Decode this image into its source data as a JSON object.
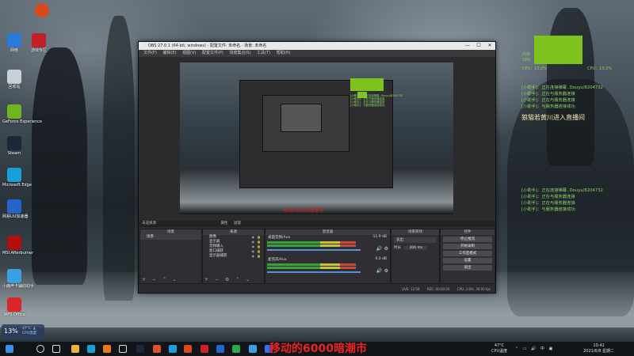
{
  "desktop": {
    "icons": [
      {
        "label": "网络",
        "icon": "network-icon",
        "color": "#2a7ad8"
      },
      {
        "label": "游戏专区",
        "icon": "game-zone-icon",
        "color": "#c0202a"
      },
      {
        "label": "回收站",
        "icon": "recycle-bin-icon",
        "color": "#c8d0d8"
      },
      {
        "label": "GeForce Experience",
        "icon": "geforce-icon",
        "color": "#6fb520"
      },
      {
        "label": "Steam",
        "icon": "steam-icon",
        "color": "#1b2838"
      },
      {
        "label": "Microsoft Edge",
        "icon": "edge-icon",
        "color": "#1aa0d8"
      },
      {
        "label": "网易UU加速器",
        "icon": "uu-accelerator-icon",
        "color": "#2563c8"
      },
      {
        "label": "MSI Afterburner",
        "icon": "afterburner-icon",
        "color": "#b01010"
      },
      {
        "label": "小鹿声卡辅助助手",
        "icon": "deer-icon",
        "color": "#3aa0e0"
      },
      {
        "label": "WPS Office",
        "icon": "wps-icon",
        "color": "#d8262a"
      }
    ],
    "top_icons": [
      {
        "label": "",
        "icon": "app-icon",
        "color": "#d84a1a"
      }
    ]
  },
  "stats_widget": {
    "bar_color": "#7ec21c",
    "lines": [
      "内存",
      "GPU",
      "CPU：15.2%",
      "CPU：13.2%"
    ]
  },
  "chat_top": [
    "[小助手]：正在连接弹幕..Douyu/8204732",
    "[小助手]：正在与服务器连接",
    "[小助手]：正在与服务器连接",
    "[小助手]：与服务器连接成功"
  ],
  "chat_highlight": "狼猫若黄川进入直播间",
  "chat_bottom": [
    "[小助手]：正在连接弹幕..Douyu/8204732",
    "[小助手]：正在与服务器连接",
    "[小助手]：正在与服务器连接",
    "[小助手]：与服务器连接成功"
  ],
  "obs": {
    "title": "OBS 27.0.1 (64-bit, windows) - 配置文件: 未命名 - 场景: 未命名",
    "menu": [
      "文件(F)",
      "编辑(E)",
      "视图(V)",
      "配置文件(P)",
      "场景集合(S)",
      "工具(T)",
      "帮助(H)"
    ],
    "preview_caption": "移动的6000暗潮市",
    "source_bar": {
      "label": "未选择源",
      "props": "属性",
      "filters": "滤镜"
    },
    "docks": {
      "scenes": {
        "header": "场景",
        "items": [
          "场景"
        ]
      },
      "sources": {
        "header": "来源",
        "items": [
          "图像",
          "显示器",
          "音频输入",
          "窗口捕获",
          "显示器捕获"
        ]
      },
      "mixer": {
        "header": "混音器",
        "channels": [
          {
            "name": "桌面音频/Aux",
            "db": "-11.9 dB"
          },
          {
            "name": "麦克风/Aux",
            "db": "0.0 dB"
          }
        ]
      },
      "transitions": {
        "header": "场景转场",
        "type": "淡出",
        "duration_label": "时长",
        "duration": "300 ms"
      },
      "controls": {
        "header": "控件",
        "buttons": [
          "停止推流",
          "开始录制",
          "工作室模式",
          "设置",
          "退出"
        ]
      }
    },
    "status": {
      "live": "LIVE: 12:58",
      "rec": "REC: 00:00:00",
      "cpu": "CPU: 3.8%, 30.00 fps"
    }
  },
  "cpu_widget": {
    "percent": "13%",
    "temp": "47°C 🌡",
    "label": "CPU温度"
  },
  "bottom_caption": "移动的6000暗潮市",
  "taskbar": {
    "icons": [
      {
        "icon": "windows-start-icon",
        "color": "#3b8fe8"
      },
      {
        "icon": "search-icon",
        "color": "#dddddd"
      },
      {
        "icon": "task-view-icon",
        "color": "#dddddd"
      },
      {
        "icon": "file-explorer-icon",
        "color": "#e8b43a"
      },
      {
        "icon": "edge-taskbar-icon",
        "color": "#1aa0d8"
      },
      {
        "icon": "fire-icon",
        "color": "#e87a1a"
      },
      {
        "icon": "obs-taskbar-icon",
        "color": "#dddddd"
      },
      {
        "icon": "steam-taskbar-icon",
        "color": "#1b2838"
      },
      {
        "icon": "chrome-icon",
        "color": "#e0502a"
      },
      {
        "icon": "edge2-icon",
        "color": "#1aa0d8"
      },
      {
        "icon": "game-icon",
        "color": "#d84a1a"
      },
      {
        "icon": "record-icon",
        "color": "#d0202a"
      },
      {
        "icon": "uu-icon",
        "color": "#2563c8"
      },
      {
        "icon": "photo-icon",
        "color": "#2aa84a"
      },
      {
        "icon": "deer-taskbar-icon",
        "color": "#3aa0e0"
      },
      {
        "icon": "screenshot-icon",
        "color": "#3b6fe8"
      }
    ],
    "temp": "47°C",
    "temp_label": "CPU温度",
    "time": "10:42",
    "date": "2021/6/8 星期二"
  }
}
